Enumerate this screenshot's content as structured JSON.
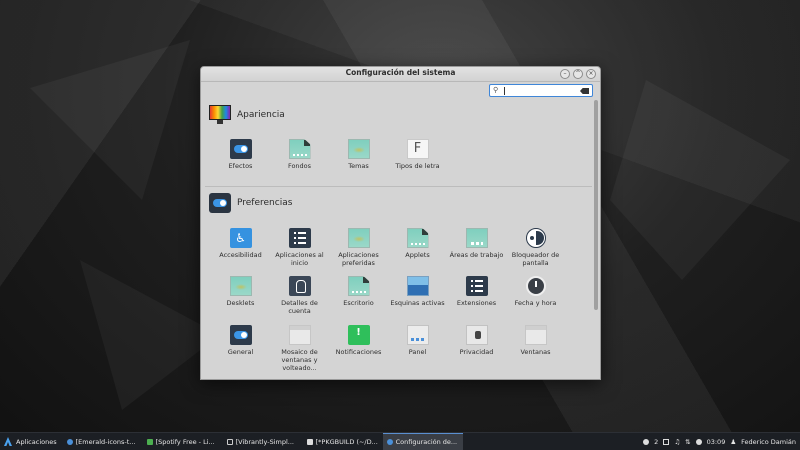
{
  "window": {
    "title": "Configuración del sistema",
    "buttons": {
      "minimize": "–",
      "maximize": "^",
      "close": "×"
    },
    "search": {
      "value": "",
      "placeholder": ""
    }
  },
  "sections": {
    "appearance": {
      "title": "Apariencia",
      "items": [
        "Efectos",
        "Fondos",
        "Temas",
        "Tipos de letra"
      ],
      "letter_icon": "F"
    },
    "preferences": {
      "title": "Preferencias",
      "items": [
        "Accesibilidad",
        "Aplicaciones al inicio",
        "Aplicaciones preferidas",
        "Applets",
        "Áreas de trabajo",
        "Bloqueador de pantalla",
        "Desklets",
        "Detalles de cuenta",
        "Escritorio",
        "Esquinas activas",
        "Extensiones",
        "Fecha y hora",
        "General",
        "Mosaico de ventanas y volteado...",
        "Notificaciones",
        "Panel",
        "Privacidad",
        "Ventanas"
      ],
      "accessibility_glyph": "♿"
    }
  },
  "taskbar": {
    "menu_label": "Aplicaciones",
    "tasks": [
      "[Emerald-icons-t...",
      "[Spotify Free - Li...",
      "[Vibrantly-Simpl...",
      "[*PKGBUILD (~/D...",
      "Configuración de..."
    ],
    "workspace": "2",
    "clock": "03:09",
    "user": "Federico Damián"
  },
  "colors": {
    "accent": "#3b95e6",
    "window_bg": "#d4d4d4",
    "taskbar_bg": "#1c1f24"
  }
}
